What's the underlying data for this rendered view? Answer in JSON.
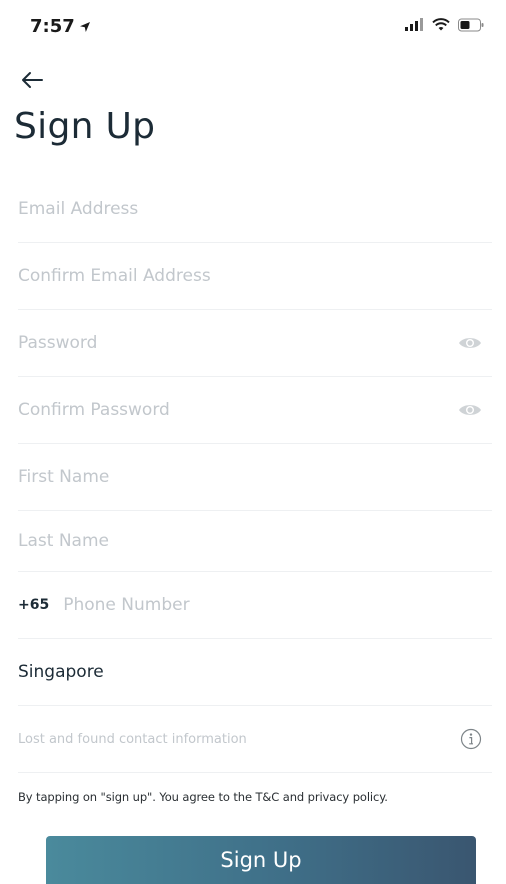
{
  "status_bar": {
    "time": "7:57",
    "location_icon": "location-arrow-icon",
    "signal_icon": "signal-icon",
    "wifi_icon": "wifi-icon",
    "battery_icon": "battery-icon"
  },
  "header": {
    "back_icon": "arrow-left-icon",
    "title": "Sign Up"
  },
  "form": {
    "email_placeholder": "Email Address",
    "confirm_email_placeholder": "Confirm Email Address",
    "password_placeholder": "Password",
    "confirm_password_placeholder": "Confirm Password",
    "first_name_placeholder": "First Name",
    "last_name_placeholder": "Last Name",
    "phone_prefix": "+65",
    "phone_placeholder": "Phone Number",
    "country_value": "Singapore",
    "lost_found_placeholder": "Lost and found contact information",
    "eye_icon": "eye-icon",
    "info_icon": "info-icon"
  },
  "terms_text": "By tapping on \"sign up\". You agree to the T&C and privacy policy.",
  "signup_label": "Sign Up",
  "colors": {
    "title_text": "#1c2b36",
    "placeholder": "#c2c7cc",
    "divider": "#eef0f2",
    "button_gradient_start": "#4a8a9c",
    "button_gradient_end": "#3a5670"
  }
}
